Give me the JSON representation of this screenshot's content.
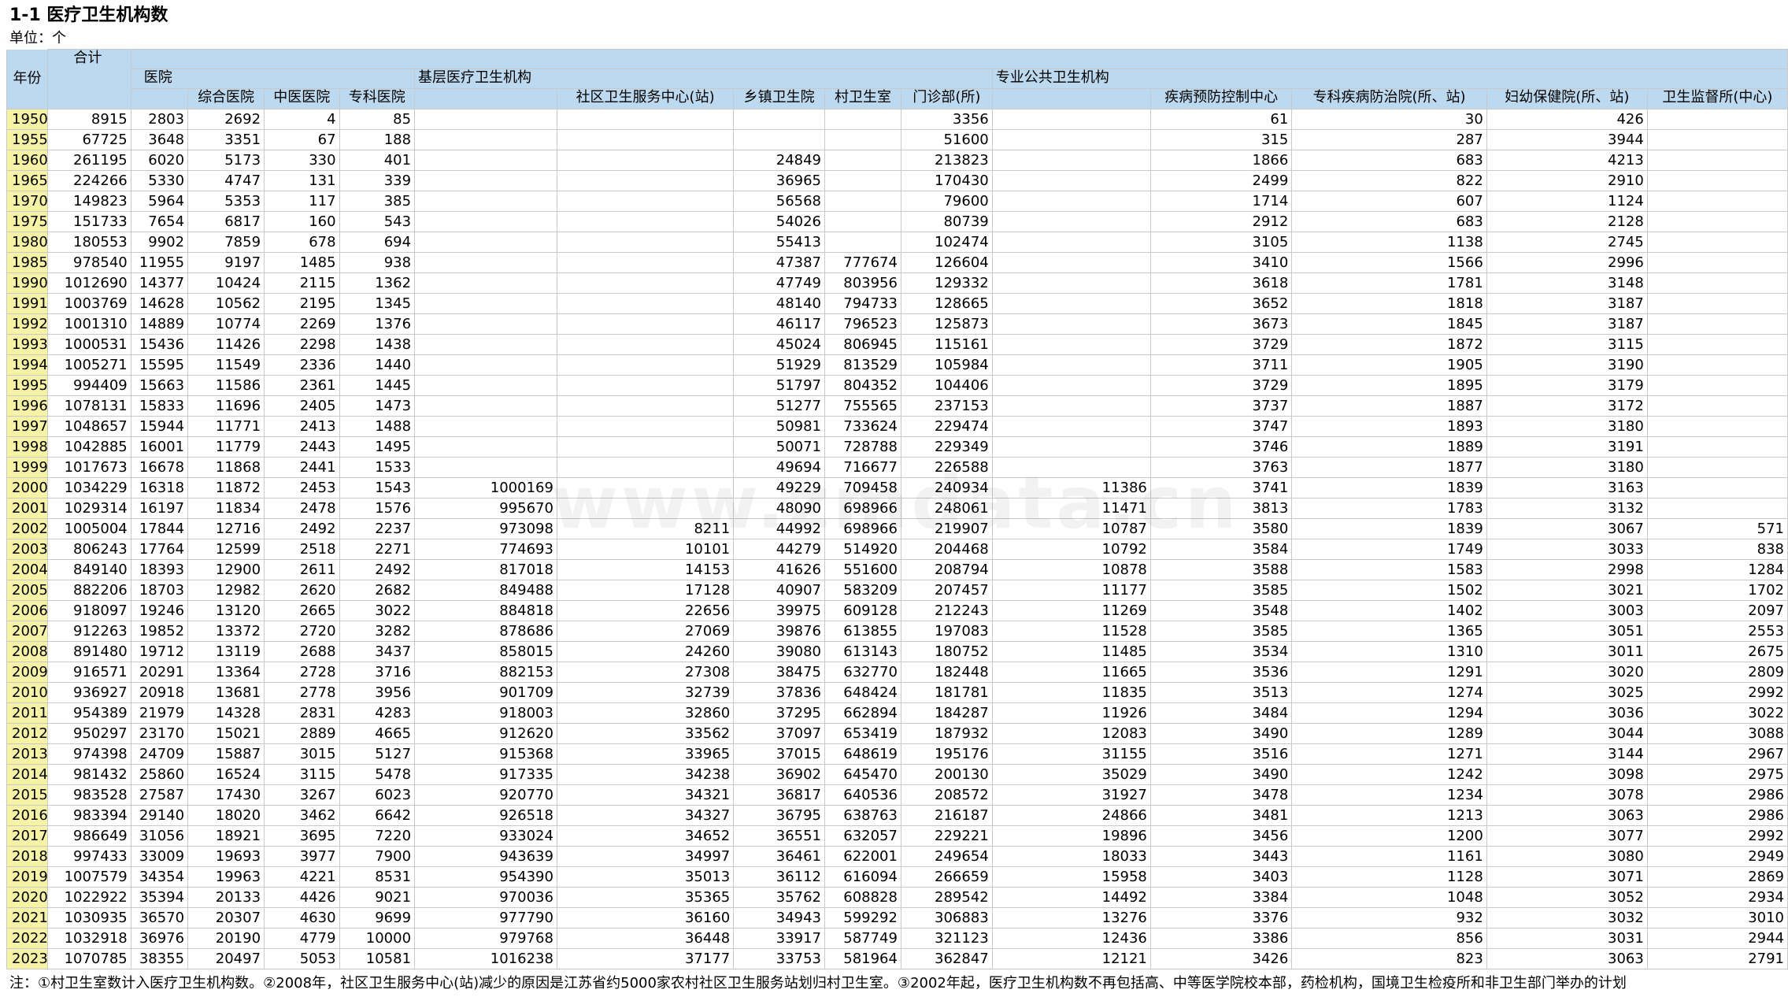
{
  "title": "1-1 医疗卫生机构数",
  "unit": "单位：个",
  "watermark": "www.zmdata.cn",
  "headers": {
    "year": "年份",
    "total": "合计",
    "hospital": "医院",
    "general_hospital": "综合医院",
    "tcm_hospital": "中医医院",
    "specialty_hospital": "专科医院",
    "primary": "基层医疗卫生机构",
    "community_center": "社区卫生服务中心(站)",
    "township_hospital": "乡镇卫生院",
    "village_clinic": "村卫生室",
    "outpatient": "门诊部(所)",
    "public_health": "专业公共卫生机构",
    "cdc": "疾病预防控制中心",
    "specialty_prevention": "专科疾病防治院(所、站)",
    "maternal_child": "妇幼保健院(所、站)",
    "health_supervision": "卫生监督所(中心)"
  },
  "rows": [
    [
      "1950",
      "8915",
      "2803",
      "2692",
      "4",
      "85",
      "",
      "",
      "",
      "",
      "3356",
      "",
      "61",
      "30",
      "426",
      ""
    ],
    [
      "1955",
      "67725",
      "3648",
      "3351",
      "67",
      "188",
      "",
      "",
      "",
      "",
      "51600",
      "",
      "315",
      "287",
      "3944",
      ""
    ],
    [
      "1960",
      "261195",
      "6020",
      "5173",
      "330",
      "401",
      "",
      "",
      "24849",
      "",
      "213823",
      "",
      "1866",
      "683",
      "4213",
      ""
    ],
    [
      "1965",
      "224266",
      "5330",
      "4747",
      "131",
      "339",
      "",
      "",
      "36965",
      "",
      "170430",
      "",
      "2499",
      "822",
      "2910",
      ""
    ],
    [
      "1970",
      "149823",
      "5964",
      "5353",
      "117",
      "385",
      "",
      "",
      "56568",
      "",
      "79600",
      "",
      "1714",
      "607",
      "1124",
      ""
    ],
    [
      "1975",
      "151733",
      "7654",
      "6817",
      "160",
      "543",
      "",
      "",
      "54026",
      "",
      "80739",
      "",
      "2912",
      "683",
      "2128",
      ""
    ],
    [
      "1980",
      "180553",
      "9902",
      "7859",
      "678",
      "694",
      "",
      "",
      "55413",
      "",
      "102474",
      "",
      "3105",
      "1138",
      "2745",
      ""
    ],
    [
      "1985",
      "978540",
      "11955",
      "9197",
      "1485",
      "938",
      "",
      "",
      "47387",
      "777674",
      "126604",
      "",
      "3410",
      "1566",
      "2996",
      ""
    ],
    [
      "1990",
      "1012690",
      "14377",
      "10424",
      "2115",
      "1362",
      "",
      "",
      "47749",
      "803956",
      "129332",
      "",
      "3618",
      "1781",
      "3148",
      ""
    ],
    [
      "1991",
      "1003769",
      "14628",
      "10562",
      "2195",
      "1345",
      "",
      "",
      "48140",
      "794733",
      "128665",
      "",
      "3652",
      "1818",
      "3187",
      ""
    ],
    [
      "1992",
      "1001310",
      "14889",
      "10774",
      "2269",
      "1376",
      "",
      "",
      "46117",
      "796523",
      "125873",
      "",
      "3673",
      "1845",
      "3187",
      ""
    ],
    [
      "1993",
      "1000531",
      "15436",
      "11426",
      "2298",
      "1438",
      "",
      "",
      "45024",
      "806945",
      "115161",
      "",
      "3729",
      "1872",
      "3115",
      ""
    ],
    [
      "1994",
      "1005271",
      "15595",
      "11549",
      "2336",
      "1440",
      "",
      "",
      "51929",
      "813529",
      "105984",
      "",
      "3711",
      "1905",
      "3190",
      ""
    ],
    [
      "1995",
      "994409",
      "15663",
      "11586",
      "2361",
      "1445",
      "",
      "",
      "51797",
      "804352",
      "104406",
      "",
      "3729",
      "1895",
      "3179",
      ""
    ],
    [
      "1996",
      "1078131",
      "15833",
      "11696",
      "2405",
      "1473",
      "",
      "",
      "51277",
      "755565",
      "237153",
      "",
      "3737",
      "1887",
      "3172",
      ""
    ],
    [
      "1997",
      "1048657",
      "15944",
      "11771",
      "2413",
      "1488",
      "",
      "",
      "50981",
      "733624",
      "229474",
      "",
      "3747",
      "1893",
      "3180",
      ""
    ],
    [
      "1998",
      "1042885",
      "16001",
      "11779",
      "2443",
      "1495",
      "",
      "",
      "50071",
      "728788",
      "229349",
      "",
      "3746",
      "1889",
      "3191",
      ""
    ],
    [
      "1999",
      "1017673",
      "16678",
      "11868",
      "2441",
      "1533",
      "",
      "",
      "49694",
      "716677",
      "226588",
      "",
      "3763",
      "1877",
      "3180",
      ""
    ],
    [
      "2000",
      "1034229",
      "16318",
      "11872",
      "2453",
      "1543",
      "1000169",
      "",
      "49229",
      "709458",
      "240934",
      "11386",
      "3741",
      "1839",
      "3163",
      ""
    ],
    [
      "2001",
      "1029314",
      "16197",
      "11834",
      "2478",
      "1576",
      "995670",
      "",
      "48090",
      "698966",
      "248061",
      "11471",
      "3813",
      "1783",
      "3132",
      ""
    ],
    [
      "2002",
      "1005004",
      "17844",
      "12716",
      "2492",
      "2237",
      "973098",
      "8211",
      "44992",
      "698966",
      "219907",
      "10787",
      "3580",
      "1839",
      "3067",
      "571"
    ],
    [
      "2003",
      "806243",
      "17764",
      "12599",
      "2518",
      "2271",
      "774693",
      "10101",
      "44279",
      "514920",
      "204468",
      "10792",
      "3584",
      "1749",
      "3033",
      "838"
    ],
    [
      "2004",
      "849140",
      "18393",
      "12900",
      "2611",
      "2492",
      "817018",
      "14153",
      "41626",
      "551600",
      "208794",
      "10878",
      "3588",
      "1583",
      "2998",
      "1284"
    ],
    [
      "2005",
      "882206",
      "18703",
      "12982",
      "2620",
      "2682",
      "849488",
      "17128",
      "40907",
      "583209",
      "207457",
      "11177",
      "3585",
      "1502",
      "3021",
      "1702"
    ],
    [
      "2006",
      "918097",
      "19246",
      "13120",
      "2665",
      "3022",
      "884818",
      "22656",
      "39975",
      "609128",
      "212243",
      "11269",
      "3548",
      "1402",
      "3003",
      "2097"
    ],
    [
      "2007",
      "912263",
      "19852",
      "13372",
      "2720",
      "3282",
      "878686",
      "27069",
      "39876",
      "613855",
      "197083",
      "11528",
      "3585",
      "1365",
      "3051",
      "2553"
    ],
    [
      "2008",
      "891480",
      "19712",
      "13119",
      "2688",
      "3437",
      "858015",
      "24260",
      "39080",
      "613143",
      "180752",
      "11485",
      "3534",
      "1310",
      "3011",
      "2675"
    ],
    [
      "2009",
      "916571",
      "20291",
      "13364",
      "2728",
      "3716",
      "882153",
      "27308",
      "38475",
      "632770",
      "182448",
      "11665",
      "3536",
      "1291",
      "3020",
      "2809"
    ],
    [
      "2010",
      "936927",
      "20918",
      "13681",
      "2778",
      "3956",
      "901709",
      "32739",
      "37836",
      "648424",
      "181781",
      "11835",
      "3513",
      "1274",
      "3025",
      "2992"
    ],
    [
      "2011",
      "954389",
      "21979",
      "14328",
      "2831",
      "4283",
      "918003",
      "32860",
      "37295",
      "662894",
      "184287",
      "11926",
      "3484",
      "1294",
      "3036",
      "3022"
    ],
    [
      "2012",
      "950297",
      "23170",
      "15021",
      "2889",
      "4665",
      "912620",
      "33562",
      "37097",
      "653419",
      "187932",
      "12083",
      "3490",
      "1289",
      "3044",
      "3088"
    ],
    [
      "2013",
      "974398",
      "24709",
      "15887",
      "3015",
      "5127",
      "915368",
      "33965",
      "37015",
      "648619",
      "195176",
      "31155",
      "3516",
      "1271",
      "3144",
      "2967"
    ],
    [
      "2014",
      "981432",
      "25860",
      "16524",
      "3115",
      "5478",
      "917335",
      "34238",
      "36902",
      "645470",
      "200130",
      "35029",
      "3490",
      "1242",
      "3098",
      "2975"
    ],
    [
      "2015",
      "983528",
      "27587",
      "17430",
      "3267",
      "6023",
      "920770",
      "34321",
      "36817",
      "640536",
      "208572",
      "31927",
      "3478",
      "1234",
      "3078",
      "2986"
    ],
    [
      "2016",
      "983394",
      "29140",
      "18020",
      "3462",
      "6642",
      "926518",
      "34327",
      "36795",
      "638763",
      "216187",
      "24866",
      "3481",
      "1213",
      "3063",
      "2986"
    ],
    [
      "2017",
      "986649",
      "31056",
      "18921",
      "3695",
      "7220",
      "933024",
      "34652",
      "36551",
      "632057",
      "229221",
      "19896",
      "3456",
      "1200",
      "3077",
      "2992"
    ],
    [
      "2018",
      "997433",
      "33009",
      "19693",
      "3977",
      "7900",
      "943639",
      "34997",
      "36461",
      "622001",
      "249654",
      "18033",
      "3443",
      "1161",
      "3080",
      "2949"
    ],
    [
      "2019",
      "1007579",
      "34354",
      "19963",
      "4221",
      "8531",
      "954390",
      "35013",
      "36112",
      "616094",
      "266659",
      "15958",
      "3403",
      "1128",
      "3071",
      "2869"
    ],
    [
      "2020",
      "1022922",
      "35394",
      "20133",
      "4426",
      "9021",
      "970036",
      "35365",
      "35762",
      "608828",
      "289542",
      "14492",
      "3384",
      "1048",
      "3052",
      "2934"
    ],
    [
      "2021",
      "1030935",
      "36570",
      "20307",
      "4630",
      "9699",
      "977790",
      "36160",
      "34943",
      "599292",
      "306883",
      "13276",
      "3376",
      "932",
      "3032",
      "3010"
    ],
    [
      "2022",
      "1032918",
      "36976",
      "20190",
      "4779",
      "10000",
      "979768",
      "36448",
      "33917",
      "587749",
      "321123",
      "12436",
      "3386",
      "856",
      "3031",
      "2944"
    ],
    [
      "2023",
      "1070785",
      "38355",
      "20497",
      "5053",
      "10581",
      "1016238",
      "37177",
      "33753",
      "581964",
      "362847",
      "12121",
      "3426",
      "823",
      "3063",
      "2791"
    ]
  ],
  "footnote": "注：①村卫生室数计入医疗卫生机构数。②2008年，社区卫生服务中心(站)减少的原因是江苏省约5000家农村社区卫生服务站划归村卫生室。③2002年起，医疗卫生机构数不再包括高、中等医学院校本部，药检机构，国境卫生检疫所和非卫生部门举办的计划"
}
